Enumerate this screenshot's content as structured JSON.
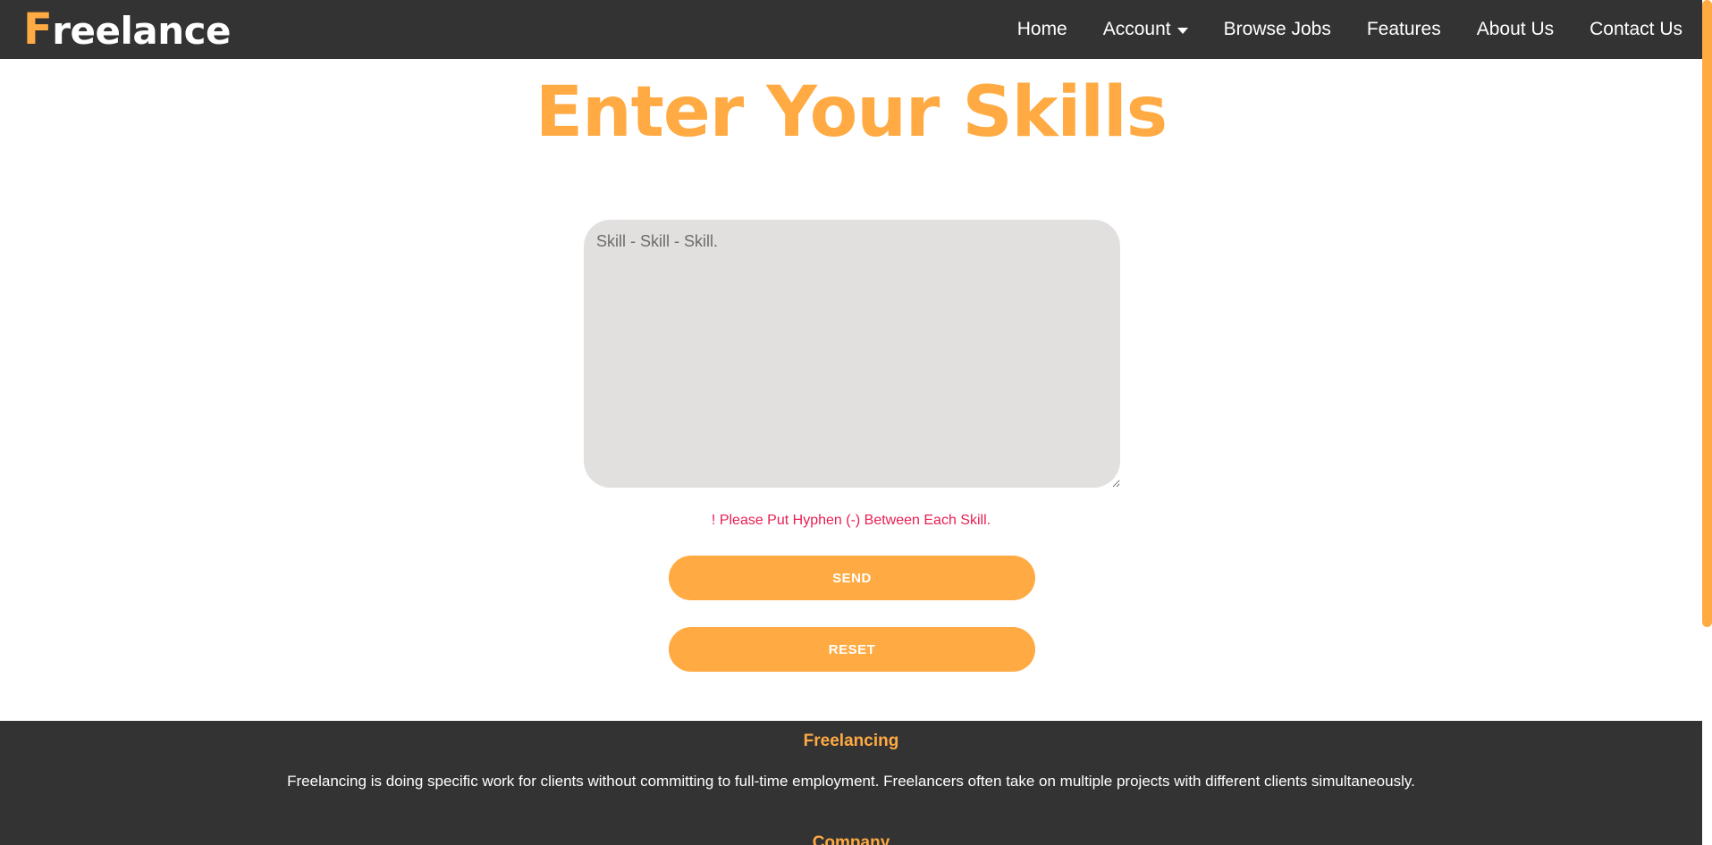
{
  "navbar": {
    "logo_first": "F",
    "logo_rest": "reelance",
    "links": [
      {
        "label": "Home"
      },
      {
        "label": "Account"
      },
      {
        "label": "Browse Jobs"
      },
      {
        "label": "Features"
      },
      {
        "label": "About Us"
      },
      {
        "label": "Contact Us"
      }
    ]
  },
  "main": {
    "title": "Enter Your Skills",
    "textarea_placeholder": "Skill - Skill - Skill.",
    "textarea_value": "",
    "hint": "! Please Put Hyphen (-) Between Each Skill.",
    "send_label": "SEND",
    "reset_label": "RESET"
  },
  "footer": {
    "heading": "Freelancing",
    "text": "Freelancing is doing specific work for clients without committing to full-time employment. Freelancers often take on multiple projects with different clients simultaneously.",
    "heading2": "Company"
  },
  "colors": {
    "accent": "#ffaa42",
    "dark": "#333333",
    "textarea_bg": "#e2dfdf",
    "hint": "#e91e52"
  }
}
